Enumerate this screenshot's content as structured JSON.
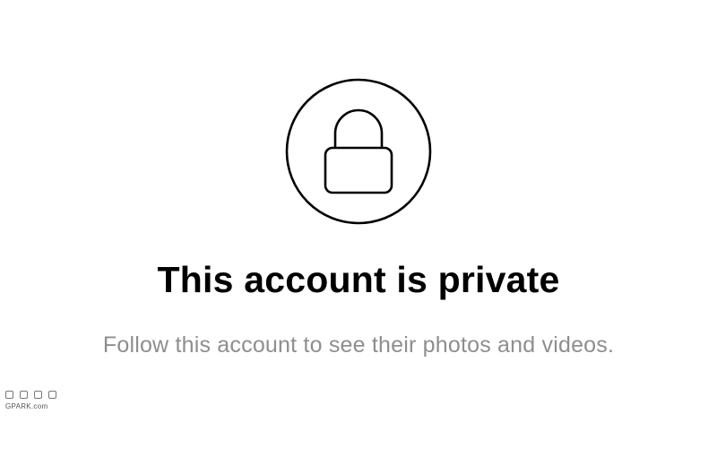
{
  "private_account": {
    "icon": "lock-icon",
    "title": "This account is private",
    "message": "Follow this account to see their photos and videos."
  },
  "watermark": {
    "logo_glyphs": "",
    "text": "GPARK.com"
  },
  "colors": {
    "background": "#ffffff",
    "title": "#000000",
    "message": "#8e8e8e",
    "icon_stroke": "#000000"
  }
}
